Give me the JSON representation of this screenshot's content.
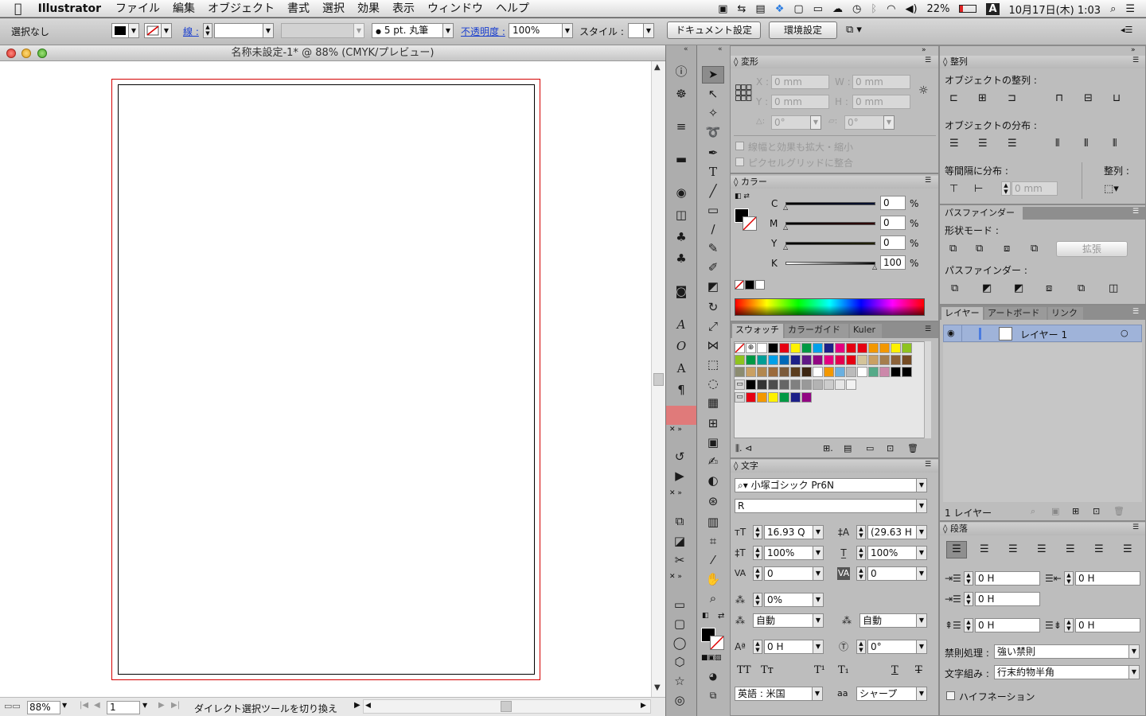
{
  "menubar": {
    "app": "Illustrator",
    "items": [
      "ファイル",
      "編集",
      "オブジェクト",
      "書式",
      "選択",
      "効果",
      "表示",
      "ウィンドウ",
      "ヘルプ"
    ],
    "battery": "22%",
    "input_mode": "A",
    "datetime": "10月17日(木) 1:03"
  },
  "control_bar": {
    "selection_label": "選択なし",
    "stroke_label": "線 :",
    "brush_value": "5 pt. 丸筆",
    "opacity_label": "不透明度 :",
    "opacity_value": "100%",
    "style_label": "スタイル :",
    "doc_settings": "ドキュメント設定",
    "env_settings": "環境設定"
  },
  "document": {
    "title": "名称未設定-1* @ 88% (CMYK/プレビュー)",
    "zoom": "88%",
    "artboard_num": "1",
    "status_text": "ダイレクト選択ツールを切り換え"
  },
  "transform_panel": {
    "tab": "変形",
    "x_label": "X :",
    "x_value": "0 mm",
    "y_label": "Y :",
    "y_value": "0 mm",
    "w_label": "W :",
    "w_value": "0 mm",
    "h_label": "H :",
    "h_value": "0 mm",
    "angle_value": "0°",
    "shear_value": "0°",
    "scale_strokes": "線幅と効果も拡大・縮小",
    "pixel_grid": "ピクセルグリッドに整合"
  },
  "color_panel": {
    "tab": "カラー",
    "channels": [
      {
        "label": "C",
        "value": "0"
      },
      {
        "label": "M",
        "value": "0"
      },
      {
        "label": "Y",
        "value": "0"
      },
      {
        "label": "K",
        "value": "100"
      }
    ],
    "unit": "%"
  },
  "swatch_panel": {
    "tabs": [
      "スウォッチ",
      "カラーガイド",
      "Kuler"
    ]
  },
  "character_panel": {
    "tab": "文字",
    "font": "小塚ゴシック Pr6N",
    "style": "R",
    "size": "16.93 Q",
    "leading": "(29.63 H",
    "v_scale": "100%",
    "h_scale": "100%",
    "kerning": "0",
    "tracking": "0",
    "tsume": "0%",
    "aki_left": "自動",
    "aki_right": "自動",
    "baseline": "0 H",
    "rotation": "0°",
    "language": "英語 : 米国",
    "antialias": "シャープ",
    "aa_label": "aa"
  },
  "align_panel": {
    "tab": "整列",
    "align_objects": "オブジェクトの整列 :",
    "distribute_objects": "オブジェクトの分布 :",
    "distribute_spacing": "等間隔に分布 :",
    "align_to": "整列 :",
    "spacing_value": "0 mm"
  },
  "pathfinder_panel": {
    "tab": "パスファインダー",
    "shape_modes": "形状モード :",
    "pathfinders": "パスファインダー :",
    "expand": "拡張"
  },
  "layers_panel": {
    "tabs": [
      "レイヤー",
      "アートボード",
      "リンク"
    ],
    "layer_name": "レイヤー 1",
    "count": "1 レイヤー"
  },
  "paragraph_panel": {
    "tab": "段落",
    "left_indent": "0 H",
    "right_indent": "0 H",
    "first_indent": "0 H",
    "space_before": "0 H",
    "space_after": "0 H",
    "kinsoku_label": "禁則処理 :",
    "kinsoku_value": "強い禁則",
    "mojikumi_label": "文字組み :",
    "mojikumi_value": "行末約物半角",
    "hyphenation": "ハイフネーション"
  }
}
